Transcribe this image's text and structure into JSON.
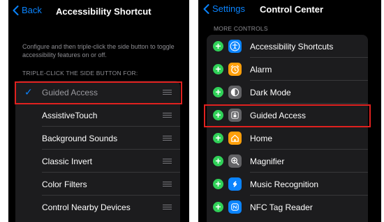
{
  "left": {
    "back_label": "Back",
    "title": "Accessibility Shortcut",
    "hint": "Configure and then triple-click the side button to toggle accessibility features on or off.",
    "section_header": "TRIPLE-CLICK THE SIDE BUTTON FOR:",
    "items": [
      {
        "label": "Guided Access",
        "checked": true
      },
      {
        "label": "AssistiveTouch",
        "checked": false
      },
      {
        "label": "Background Sounds",
        "checked": false
      },
      {
        "label": "Classic Invert",
        "checked": false
      },
      {
        "label": "Color Filters",
        "checked": false
      },
      {
        "label": "Control Nearby Devices",
        "checked": false
      }
    ]
  },
  "right": {
    "back_label": "Settings",
    "title": "Control Center",
    "section_header": "MORE CONTROLS",
    "items": [
      {
        "label": "Accessibility Shortcuts",
        "icon": "accessibility-icon",
        "color": "#0a84ff"
      },
      {
        "label": "Alarm",
        "icon": "alarm-clock-icon",
        "color": "#ff9f0a"
      },
      {
        "label": "Dark Mode",
        "icon": "dark-mode-icon",
        "color": "#636366"
      },
      {
        "label": "Guided Access",
        "icon": "lock-icon",
        "color": "#636366"
      },
      {
        "label": "Home",
        "icon": "home-icon",
        "color": "#ff9f0a"
      },
      {
        "label": "Magnifier",
        "icon": "magnifier-icon",
        "color": "#636366"
      },
      {
        "label": "Music Recognition",
        "icon": "shazam-icon",
        "color": "#0a84ff"
      },
      {
        "label": "NFC Tag Reader",
        "icon": "nfc-icon",
        "color": "#0a84ff"
      }
    ]
  },
  "colors": {
    "accent": "#0a84ff",
    "add": "#30d158",
    "highlight": "#e0211f"
  }
}
